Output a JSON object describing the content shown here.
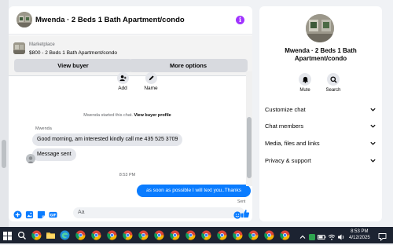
{
  "chat": {
    "title": "Mwenda · 2 Beds 1 Bath Apartment/condo",
    "marketplace_label": "Marketplace",
    "listing": "$800 - 2 Beds 1 Bath Apartment/condo",
    "view_buyer_label": "View buyer",
    "more_options_label": "More options",
    "add_label": "Add",
    "name_label": "Name",
    "system_message": "Mwenda started this chat.",
    "view_profile_link": "View buyer profile",
    "sender_name": "Mwenda",
    "message_1": "Good morning,  am interested kindly call me 435 525 3709",
    "message_2": "Message sent",
    "timestamp": "8:53 PM",
    "outgoing_message": "as soon as possible I will text you..Thanks",
    "sent_status": "Sent",
    "input_placeholder": "Aa"
  },
  "side": {
    "title": "Mwenda · 2 Beds 1 Bath Apartment/condo",
    "mute_label": "Mute",
    "search_label": "Search",
    "sections": [
      "Customize chat",
      "Chat members",
      "Media, files and links",
      "Privacy & support"
    ]
  },
  "taskbar": {
    "time": "8:53 PM",
    "date": "4/12/2025"
  },
  "colors": {
    "accent": "#0a7cff",
    "info": "#a033ff",
    "taskbar": "#1c2331"
  },
  "icons": [
    "windows-start-icon",
    "chrome-icon",
    "file-explorer-icon",
    "edge-icon",
    "person-add-icon",
    "pencil-icon",
    "bell-icon",
    "search-icon",
    "plus-circle-icon",
    "image-icon",
    "sticker-icon",
    "gif-icon",
    "emoji-icon",
    "thumbs-up-icon",
    "chevron-down-icon",
    "wifi-icon",
    "volume-icon",
    "notification-icon"
  ]
}
